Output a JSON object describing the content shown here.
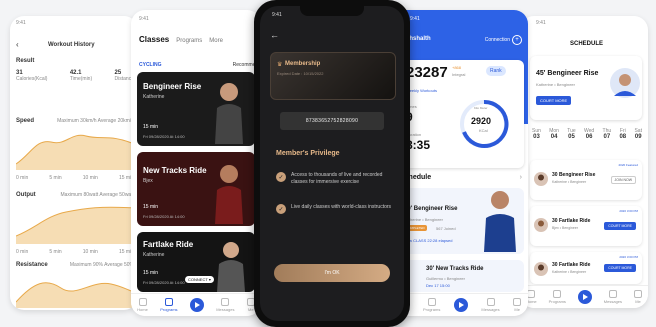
{
  "phone1": {
    "time": "9:41",
    "title": "Workout History",
    "result_label": "Result",
    "stats": [
      {
        "value": "31",
        "label": "Calories(Kcal)"
      },
      {
        "value": "42.1",
        "label": "Time(min)"
      },
      {
        "value": "25",
        "label": "Distance"
      }
    ],
    "sections": [
      {
        "title": "Speed",
        "meta": "Maximum 30km/h  Average 20km/h"
      },
      {
        "title": "Output",
        "meta": "Maximum 80watt  Average 50watt"
      },
      {
        "title": "Resistance",
        "meta": "Maximum 90%  Average 50%"
      }
    ],
    "axis": [
      "0 min",
      "5 min",
      "10 min",
      "15 min"
    ]
  },
  "phone2": {
    "time": "9:41",
    "tabs": [
      "Classes",
      "Programs",
      "More"
    ],
    "filter": "CYCLING",
    "recommend": "Recommend",
    "classes": [
      {
        "title": "Bengineer Rise",
        "coach": "Katherine",
        "meta": "15 min",
        "date": "Fri 09/28/2020 At 14:00"
      },
      {
        "title": "New Tracks Ride",
        "coach": "Bjex",
        "meta": "15 min",
        "date": "Fri 09/28/2020 At 14:00"
      },
      {
        "title": "Fartlake Ride",
        "coach": "Katherine",
        "meta": "15 min",
        "date": "Fri 09/28/2020 At 14:00",
        "button": "CONNECT ▾"
      }
    ],
    "nav": [
      "Home",
      "Programs",
      "",
      "Messages",
      "Me"
    ]
  },
  "phone3": {
    "time": "9:41",
    "membership_label": "Membership",
    "expired": "Expired Date : 10/15/2022",
    "code": "87383652752828090",
    "privilege_title": "Member's Privilege",
    "privileges": [
      "Access to thousands of live and recorded classes for immersive exercise",
      "Live daily classes with world-class instructors"
    ],
    "ok_label": "I'm OK"
  },
  "phone4": {
    "time": "9:41",
    "brand": "ahshalth",
    "connection": "Connection",
    "integral": "23287",
    "integral_delta": "+868",
    "integral_label": "Integral",
    "rank_label": "Rank",
    "weekly_label": "Weekly Workouts",
    "times_label": "Times",
    "times_value": "9",
    "duration_label": "Duration",
    "duration_value": "8:35",
    "kcal_value": "2920",
    "kcal_sub": "KCal",
    "kcal_ring": "Kilo Meter",
    "schedule_label": "Schedule",
    "cards": [
      {
        "title": "30' Bengineer Rise",
        "coach": "Katherine • Bengineer",
        "badge": "COMPLETED",
        "extra": "567 Joined",
        "date": "Now CLASS  22:28 elapsed"
      },
      {
        "title": "30' New Tracks Ride",
        "coach": "Guillermo • Bengineer",
        "date": "Dec 17 15:00"
      }
    ],
    "nav": [
      "Home",
      "Programs",
      "",
      "Messages",
      "Me"
    ]
  },
  "phone5": {
    "time": "9:41",
    "title": "SCHEDULE",
    "hero_title": "45' Bengineer Rise",
    "hero_coach": "Katherine • Bengineer",
    "hero_button": "COURT MORE",
    "days": [
      {
        "name": "Sun",
        "num": "03"
      },
      {
        "name": "Mon",
        "num": "04"
      },
      {
        "name": "Tue",
        "num": "05"
      },
      {
        "name": "Wed",
        "num": "06"
      },
      {
        "name": "Thu",
        "num": "07"
      },
      {
        "name": "Fri",
        "num": "08"
      },
      {
        "name": "Sat",
        "num": "09"
      }
    ],
    "items": [
      {
        "title": "30 Bengineer Rise",
        "coach": "Katherine • Bengineer",
        "btn": "JOIN NOW",
        "date": "2020 Featured"
      },
      {
        "title": "30 Fartlake Ride",
        "coach": "Bjex • Bengineer",
        "btn": "COURT MORE",
        "date": "2020 3:00 PM"
      },
      {
        "title": "30 Fartlake Ride",
        "coach": "Katherine • Bengineer",
        "btn": "COURT MORE",
        "date": "2020 3:00 PM"
      }
    ],
    "nav": [
      "Home",
      "Programs",
      "",
      "Messages",
      "Me"
    ]
  }
}
